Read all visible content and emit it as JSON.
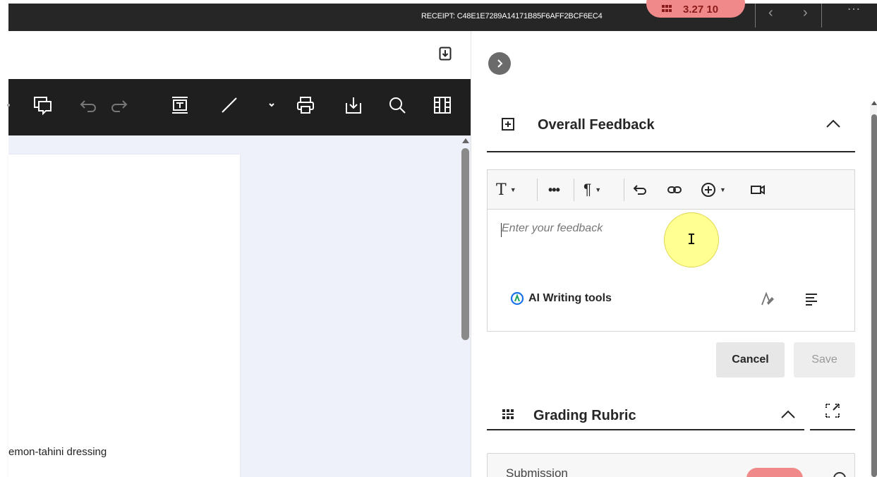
{
  "topbar": {
    "receipt_text": "RECEIPT: C48E1E7289A14171B85F6AFF2BCF6EC4",
    "score_text": "3.27 10",
    "prev_icon": "chevron-left-icon",
    "next_icon": "chevron-right-icon",
    "colors": {
      "bar": "#262626",
      "score_pill": "#f08a8a"
    }
  },
  "document": {
    "toolbar_icons": [
      "comment-icon",
      "undo-icon",
      "redo-icon",
      "text-box-icon",
      "draw-line-icon",
      "dropdown-caret-icon",
      "print-icon",
      "download-icon",
      "search-icon",
      "view-columns-icon"
    ],
    "visible_text": "emon-tahini dressing"
  },
  "feedback": {
    "section_title": "Overall Feedback",
    "placeholder": "Enter your feedback",
    "toolbar_icons": [
      "text-style-icon",
      "more-icon",
      "paragraph-icon",
      "undo-icon",
      "link-icon",
      "insert-icon",
      "video-icon"
    ],
    "ai_tools_label": "AI Writing tools",
    "cancel_label": "Cancel",
    "save_label": "Save"
  },
  "rubric": {
    "section_title": "Grading Rubric",
    "card_label": "Submission"
  }
}
